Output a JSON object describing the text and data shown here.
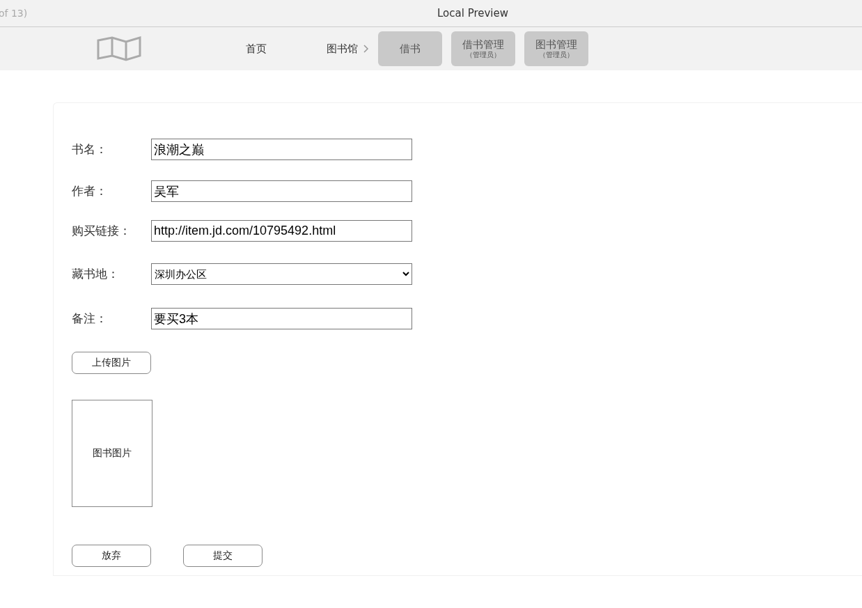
{
  "window": {
    "title": "Local Preview",
    "page_counter": "of 13)"
  },
  "nav": [
    {
      "kind": "link",
      "label": "首页",
      "chevron": false
    },
    {
      "kind": "link",
      "label": "图书馆",
      "chevron": true
    },
    {
      "kind": "button",
      "label": "借书"
    },
    {
      "kind": "button",
      "label": "借书管理",
      "sub": "（管理员）"
    },
    {
      "kind": "button",
      "label": "图书管理",
      "sub": "（管理员）"
    }
  ],
  "form": {
    "fields": [
      {
        "kind": "text",
        "label": "书名：",
        "value": "浪潮之巅"
      },
      {
        "kind": "text",
        "label": "作者：",
        "value": "吴军"
      },
      {
        "kind": "text",
        "label": "购买链接：",
        "value": "http://item.jd.com/10795492.html"
      },
      {
        "kind": "select",
        "label": "藏书地：",
        "value": "深圳办公区"
      },
      {
        "kind": "text",
        "label": "备注：",
        "value": "要买3本"
      }
    ],
    "upload_button": "上传图片",
    "image_placeholder": "图书图片",
    "actions": [
      "放弃",
      "提交"
    ]
  }
}
